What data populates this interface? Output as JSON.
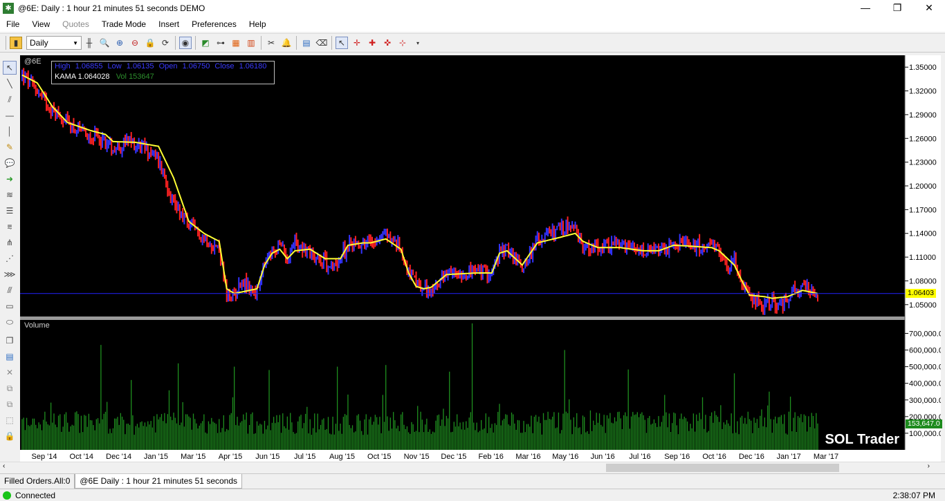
{
  "window": {
    "title": "@6E: Daily : 1 hour 21 minutes 51 seconds DEMO",
    "minimize": "—",
    "maximize": "❐",
    "close": "✕"
  },
  "menu": [
    "File",
    "View",
    "Quotes",
    "Trade Mode",
    "Insert",
    "Preferences",
    "Help"
  ],
  "toolbar": {
    "interval": "Daily"
  },
  "info_box": {
    "high_label": "High",
    "high": "1.06855",
    "low_label": "Low",
    "low": "1.06135",
    "open_label": "Open",
    "open": "1.06750",
    "close_label": "Close",
    "close": "1.06180",
    "kama_label": "KAMA",
    "kama": "1.064028",
    "vol_label": "Vol",
    "vol": "153647"
  },
  "chart": {
    "symbol": "@6E",
    "volume_label": "Volume",
    "brand": "SOL Trader",
    "last_price": "1.06403",
    "last_volume": "153,647.0",
    "colors": {
      "up": "#3333ff",
      "down": "#ff2222",
      "kama": "#ffff33",
      "volume": "#1f8f1f",
      "last_line": "#2222ff"
    }
  },
  "chart_data": {
    "type": "candlestick",
    "price_ticks": [
      "1.35000",
      "1.32000",
      "1.29000",
      "1.26000",
      "1.23000",
      "1.20000",
      "1.17000",
      "1.14000",
      "1.11000",
      "1.08000",
      "1.05000"
    ],
    "price_tick_values": [
      1.35,
      1.32,
      1.29,
      1.26,
      1.23,
      1.2,
      1.17,
      1.14,
      1.11,
      1.08,
      1.05
    ],
    "price_ylim": [
      1.035,
      1.365
    ],
    "volume_ticks": [
      "700,000.0",
      "600,000.0",
      "500,000.0",
      "400,000.0",
      "300,000.0",
      "200,000.0",
      "100,000.0"
    ],
    "volume_tick_values": [
      700000,
      600000,
      500000,
      400000,
      300000,
      200000,
      100000
    ],
    "volume_ylim": [
      0,
      760000
    ],
    "x_labels": [
      "Sep '14",
      "Oct '14",
      "Dec '14",
      "Jan '15",
      "Mar '15",
      "Apr '15",
      "Jun '15",
      "Jul '15",
      "Aug '15",
      "Oct '15",
      "Nov '15",
      "Dec '15",
      "Feb '16",
      "Mar '16",
      "May '16",
      "Jun '16",
      "Jul '16",
      "Sep '16",
      "Oct '16",
      "Dec '16",
      "Jan '17",
      "Mar '17"
    ],
    "close_path": [
      [
        0,
        1.34
      ],
      [
        10,
        1.32
      ],
      [
        20,
        1.296
      ],
      [
        30,
        1.28
      ],
      [
        40,
        1.265
      ],
      [
        50,
        1.262
      ],
      [
        60,
        1.248
      ],
      [
        70,
        1.255
      ],
      [
        80,
        1.25
      ],
      [
        90,
        1.233
      ],
      [
        100,
        1.18
      ],
      [
        110,
        1.15
      ],
      [
        120,
        1.135
      ],
      [
        130,
        1.12
      ],
      [
        135,
        1.06
      ],
      [
        140,
        1.062
      ],
      [
        145,
        1.082
      ],
      [
        150,
        1.07
      ],
      [
        155,
        1.065
      ],
      [
        160,
        1.1
      ],
      [
        165,
        1.115
      ],
      [
        170,
        1.125
      ],
      [
        175,
        1.11
      ],
      [
        180,
        1.13
      ],
      [
        190,
        1.115
      ],
      [
        200,
        1.105
      ],
      [
        205,
        1.095
      ],
      [
        210,
        1.11
      ],
      [
        215,
        1.125
      ],
      [
        220,
        1.128
      ],
      [
        230,
        1.13
      ],
      [
        240,
        1.14
      ],
      [
        250,
        1.12
      ],
      [
        255,
        1.09
      ],
      [
        260,
        1.075
      ],
      [
        265,
        1.068
      ],
      [
        270,
        1.065
      ],
      [
        275,
        1.08
      ],
      [
        285,
        1.09
      ],
      [
        300,
        1.092
      ],
      [
        310,
        1.09
      ],
      [
        315,
        1.115
      ],
      [
        320,
        1.12
      ],
      [
        330,
        1.098
      ],
      [
        340,
        1.13
      ],
      [
        350,
        1.14
      ],
      [
        360,
        1.15
      ],
      [
        365,
        1.142
      ],
      [
        370,
        1.125
      ],
      [
        380,
        1.12
      ],
      [
        390,
        1.128
      ],
      [
        400,
        1.12
      ],
      [
        410,
        1.115
      ],
      [
        420,
        1.118
      ],
      [
        430,
        1.125
      ],
      [
        440,
        1.128
      ],
      [
        450,
        1.122
      ],
      [
        460,
        1.118
      ],
      [
        465,
        1.095
      ],
      [
        470,
        1.11
      ],
      [
        475,
        1.075
      ],
      [
        480,
        1.058
      ],
      [
        485,
        1.055
      ],
      [
        490,
        1.048
      ],
      [
        495,
        1.055
      ],
      [
        500,
        1.045
      ],
      [
        505,
        1.06
      ],
      [
        510,
        1.068
      ],
      [
        515,
        1.07
      ],
      [
        520,
        1.068
      ],
      [
        525,
        1.064
      ]
    ],
    "kama_path": [
      [
        0,
        1.34
      ],
      [
        10,
        1.33
      ],
      [
        20,
        1.3
      ],
      [
        30,
        1.28
      ],
      [
        45,
        1.27
      ],
      [
        55,
        1.265
      ],
      [
        60,
        1.256
      ],
      [
        75,
        1.255
      ],
      [
        90,
        1.25
      ],
      [
        100,
        1.21
      ],
      [
        110,
        1.155
      ],
      [
        120,
        1.14
      ],
      [
        130,
        1.13
      ],
      [
        135,
        1.07
      ],
      [
        140,
        1.064
      ],
      [
        150,
        1.068
      ],
      [
        155,
        1.07
      ],
      [
        160,
        1.1
      ],
      [
        165,
        1.115
      ],
      [
        170,
        1.12
      ],
      [
        175,
        1.108
      ],
      [
        180,
        1.118
      ],
      [
        190,
        1.12
      ],
      [
        200,
        1.108
      ],
      [
        210,
        1.108
      ],
      [
        215,
        1.125
      ],
      [
        225,
        1.128
      ],
      [
        230,
        1.128
      ],
      [
        240,
        1.133
      ],
      [
        250,
        1.12
      ],
      [
        255,
        1.09
      ],
      [
        260,
        1.073
      ],
      [
        265,
        1.07
      ],
      [
        270,
        1.072
      ],
      [
        280,
        1.088
      ],
      [
        300,
        1.09
      ],
      [
        310,
        1.09
      ],
      [
        315,
        1.115
      ],
      [
        320,
        1.118
      ],
      [
        330,
        1.1
      ],
      [
        340,
        1.128
      ],
      [
        355,
        1.135
      ],
      [
        365,
        1.14
      ],
      [
        370,
        1.13
      ],
      [
        380,
        1.122
      ],
      [
        395,
        1.122
      ],
      [
        410,
        1.118
      ],
      [
        420,
        1.118
      ],
      [
        430,
        1.125
      ],
      [
        440,
        1.124
      ],
      [
        455,
        1.122
      ],
      [
        460,
        1.118
      ],
      [
        470,
        1.1
      ],
      [
        475,
        1.08
      ],
      [
        480,
        1.062
      ],
      [
        490,
        1.06
      ],
      [
        495,
        1.058
      ],
      [
        505,
        1.06
      ],
      [
        515,
        1.068
      ],
      [
        525,
        1.064
      ]
    ],
    "volume_spikes": [
      [
        52,
        520000
      ],
      [
        72,
        420000
      ],
      [
        103,
        520000
      ],
      [
        140,
        500000
      ],
      [
        163,
        480000
      ],
      [
        208,
        500000
      ],
      [
        240,
        510000
      ],
      [
        282,
        470000
      ],
      [
        297,
        760000
      ],
      [
        358,
        600000
      ],
      [
        400,
        450000
      ],
      [
        470,
        460000
      ],
      [
        493,
        350000
      ],
      [
        507,
        320000
      ]
    ],
    "last_price_value": 1.06403,
    "last_volume_value": 153647
  },
  "tabs": [
    "Filled Orders.All:0",
    "@6E Daily : 1 hour 21 minutes 51 seconds"
  ],
  "status": {
    "connection": "Connected",
    "time": "2:38:07 PM"
  }
}
